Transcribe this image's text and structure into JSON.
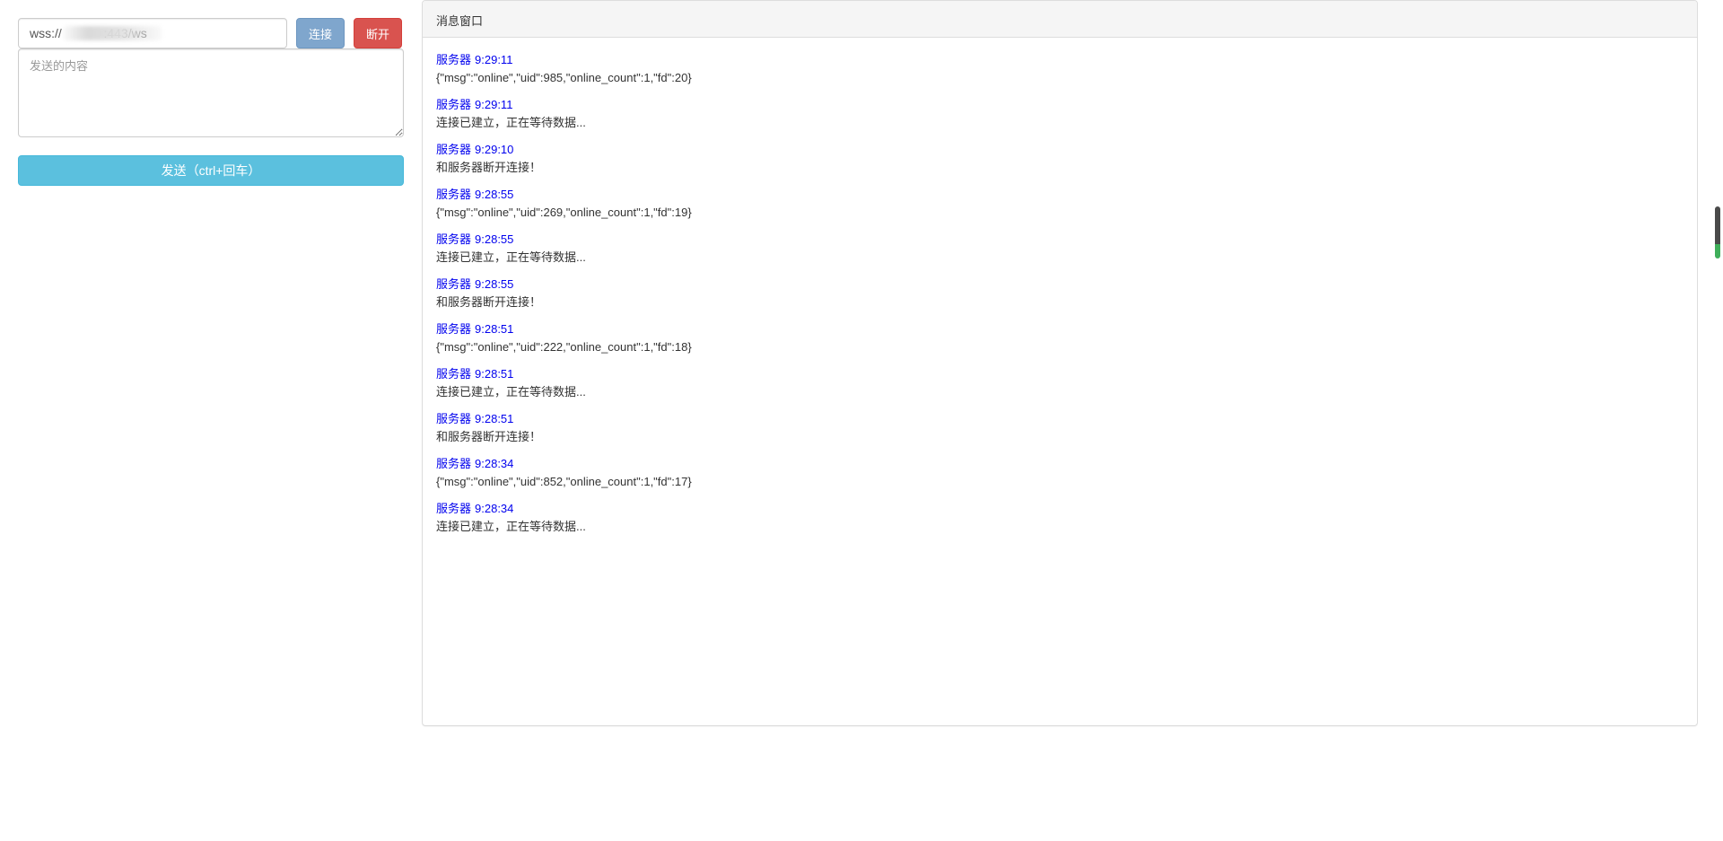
{
  "connection": {
    "url_value": "wss://            :443/ws",
    "connect_label": "连接",
    "disconnect_label": "断开"
  },
  "composer": {
    "placeholder": "发送的内容",
    "send_label": "发送（ctrl+回车）"
  },
  "panel": {
    "title": "消息窗口",
    "messages": [
      {
        "sender": "服务器",
        "time": "9:29:11",
        "text": "{\"msg\":\"online\",\"uid\":985,\"online_count\":1,\"fd\":20}"
      },
      {
        "sender": "服务器",
        "time": "9:29:11",
        "text": "连接已建立，正在等待数据..."
      },
      {
        "sender": "服务器",
        "time": "9:29:10",
        "text": "和服务器断开连接！"
      },
      {
        "sender": "服务器",
        "time": "9:28:55",
        "text": "{\"msg\":\"online\",\"uid\":269,\"online_count\":1,\"fd\":19}"
      },
      {
        "sender": "服务器",
        "time": "9:28:55",
        "text": "连接已建立，正在等待数据..."
      },
      {
        "sender": "服务器",
        "time": "9:28:55",
        "text": "和服务器断开连接！"
      },
      {
        "sender": "服务器",
        "time": "9:28:51",
        "text": "{\"msg\":\"online\",\"uid\":222,\"online_count\":1,\"fd\":18}"
      },
      {
        "sender": "服务器",
        "time": "9:28:51",
        "text": "连接已建立，正在等待数据..."
      },
      {
        "sender": "服务器",
        "time": "9:28:51",
        "text": "和服务器断开连接！"
      },
      {
        "sender": "服务器",
        "time": "9:28:34",
        "text": "{\"msg\":\"online\",\"uid\":852,\"online_count\":1,\"fd\":17}"
      },
      {
        "sender": "服务器",
        "time": "9:28:34",
        "text": "连接已建立，正在等待数据..."
      }
    ]
  },
  "colors": {
    "link_blue": "#0000ee",
    "connect_btn": "#7fa6cd",
    "disconnect_btn": "#d9534f",
    "send_btn": "#5bc0de"
  }
}
